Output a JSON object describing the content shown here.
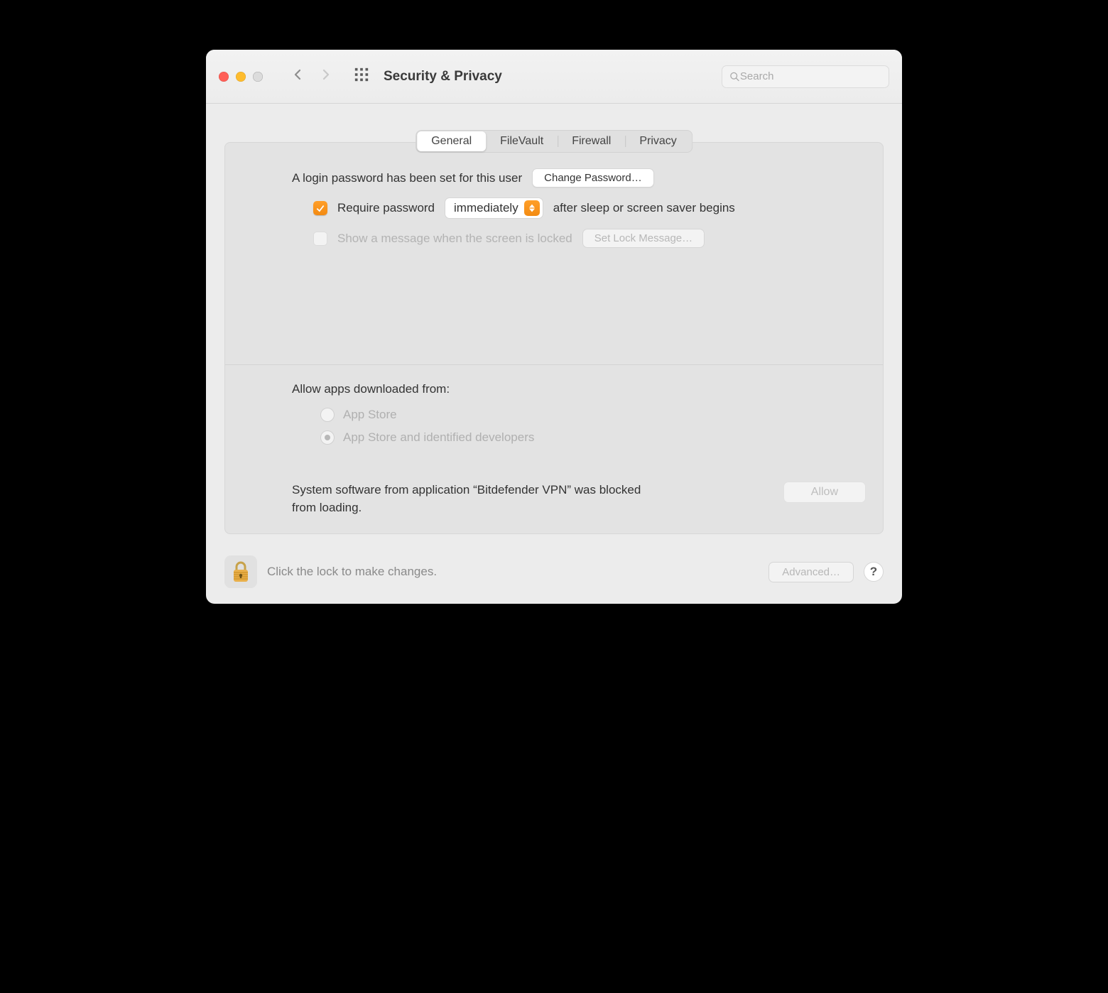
{
  "window": {
    "title": "Security & Privacy"
  },
  "search": {
    "placeholder": "Search"
  },
  "tabs": {
    "general": "General",
    "filevault": "FileVault",
    "firewall": "Firewall",
    "privacy": "Privacy"
  },
  "login": {
    "password_set_label": "A login password has been set for this user",
    "change_password_btn": "Change Password…",
    "require_password_prefix": "Require password",
    "require_password_delay": "immediately",
    "require_password_suffix": "after sleep or screen saver begins",
    "show_message_label": "Show a message when the screen is locked",
    "set_lock_message_btn": "Set Lock Message…"
  },
  "gatekeeper": {
    "section_label": "Allow apps downloaded from:",
    "option_app_store": "App Store",
    "option_identified": "App Store and identified developers",
    "blocked_text_line1": "System software from application “Bitdefender VPN” was blocked",
    "blocked_text_line2": "from loading.",
    "allow_btn": "Allow"
  },
  "footer": {
    "lock_text": "Click the lock to make changes.",
    "advanced_btn": "Advanced…",
    "help_symbol": "?"
  }
}
